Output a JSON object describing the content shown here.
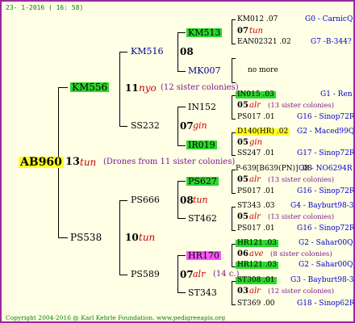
{
  "header": "23- 1-2016 ( 16: 58)",
  "footer": "Copyright 2004-2016 @ Karl Kehrle Foundation.   www.pedigreeapis.org",
  "colors": {
    "frame": "#9b2a9b",
    "bg": "#ffffe6",
    "green": "#2ed62e",
    "yellow": "#ffff22",
    "magenta": "#ff55ff",
    "blue": "#0000cc",
    "red": "#cc0000",
    "purple": "#7a1a8a"
  },
  "gen1": {
    "name": "AB960",
    "num": "13",
    "code": "tun",
    "note": "(Drones from 11 sister colonies)"
  },
  "gen2": [
    {
      "name": "KM556",
      "num": "11",
      "code": "nyo",
      "note": "(12 sister colonies)"
    },
    {
      "name": "PS538",
      "num": "10",
      "code": "tun"
    }
  ],
  "gen3": [
    {
      "name": "KM516",
      "num": "08"
    },
    {
      "name": "SS232",
      "num": "07",
      "code": "gin"
    },
    {
      "name": "PS666",
      "num": "08",
      "code": "tun"
    },
    {
      "name": "PS589",
      "num": "07",
      "code": "alr",
      "note": "(14 c.)"
    }
  ],
  "gen4": [
    {
      "name": "KM513"
    },
    {
      "name": "MK007"
    },
    {
      "name": "IN152"
    },
    {
      "name": "IR019"
    },
    {
      "name": "PS627"
    },
    {
      "name": "ST462"
    },
    {
      "name": "HR170"
    },
    {
      "name": "ST343"
    }
  ],
  "gen5": [
    {
      "top": "KM012 .07",
      "topR": "G0 - CarnicQ",
      "mid": "07",
      "code": "tun",
      "note": "",
      "bot": "EAN02321 .02",
      "botR": "G7 -B-344?"
    },
    {
      "top": "",
      "topR": "",
      "mid": "no more",
      "code": "",
      "note": "",
      "bot": "",
      "botR": ""
    },
    {
      "top": "IN015 .03",
      "topR": "G1 - Ren",
      "mid": "05",
      "code": "alr",
      "note": "(13 sister colonies)",
      "bot": "PS017 .01",
      "botR": "G16 - Sinop72R"
    },
    {
      "top": "D140(HR) .02",
      "topR": "G2 - Maced99Q",
      "mid": "05",
      "code": "gin",
      "note": "",
      "bot": "SS247 .01",
      "botR": "G17 - Sinop72R"
    },
    {
      "top": "P-639[B639(PN)] .08",
      "topR": "G8 - NO6294R",
      "mid": "05",
      "code": "alr",
      "note": "(13 sister colonies)",
      "bot": "PS017 .01",
      "botR": "G16 - Sinop72R"
    },
    {
      "top": "ST343 .03",
      "topR": "G4 - Bayburt98-3",
      "mid": "05",
      "code": "alr",
      "note": "(13 sister colonies)",
      "bot": "PS017 .01",
      "botR": "G16 - Sinop72R"
    },
    {
      "top": "HR121 .03",
      "topR": "G2 - Sahar00Q",
      "mid": "06",
      "code": "ave",
      "note": "(8 sister colonies)",
      "bot": "HR121 .03",
      "botR": "G2 - Sahar00Q"
    },
    {
      "top": "ST308 .01",
      "topR": "G3 - Bayburt98-3",
      "mid": "03",
      "code": "alr",
      "note": "(12 sister colonies)",
      "bot": "ST369 .00",
      "botR": "G18 - Sinop62R"
    }
  ]
}
